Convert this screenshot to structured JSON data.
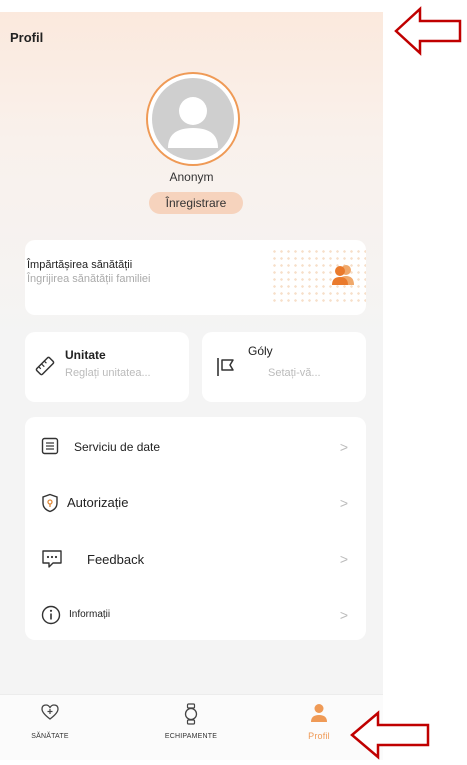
{
  "header": {
    "title": "Profil"
  },
  "profile": {
    "name": "Anonym",
    "register_label": "Înregistrare"
  },
  "share": {
    "title": "Împărtășirea sănătății",
    "subtitle": "Îngrijirea sănătății familiei"
  },
  "tiles": {
    "unit": {
      "title": "Unitate",
      "subtitle": "Reglați unitatea..."
    },
    "goals": {
      "title": "Góly",
      "subtitle": "Setați-vă..."
    }
  },
  "menu": {
    "items": [
      {
        "label": "Serviciu de date",
        "icon": "list-document-icon"
      },
      {
        "label": "Autorizație",
        "icon": "shield-icon"
      },
      {
        "label": "Feedback",
        "icon": "chat-bubble-icon"
      },
      {
        "label": "Informații",
        "icon": "info-icon"
      }
    ]
  },
  "tabbar": {
    "tabs": [
      {
        "label": "SĂNĂTATE",
        "icon": "heart-plus-icon"
      },
      {
        "label": "ECHIPAMENTE",
        "icon": "watch-icon"
      },
      {
        "label": "Profil",
        "icon": "person-icon",
        "active": true
      }
    ]
  },
  "colors": {
    "accent": "#ef9a56",
    "annotation_arrow": "#c00000"
  }
}
